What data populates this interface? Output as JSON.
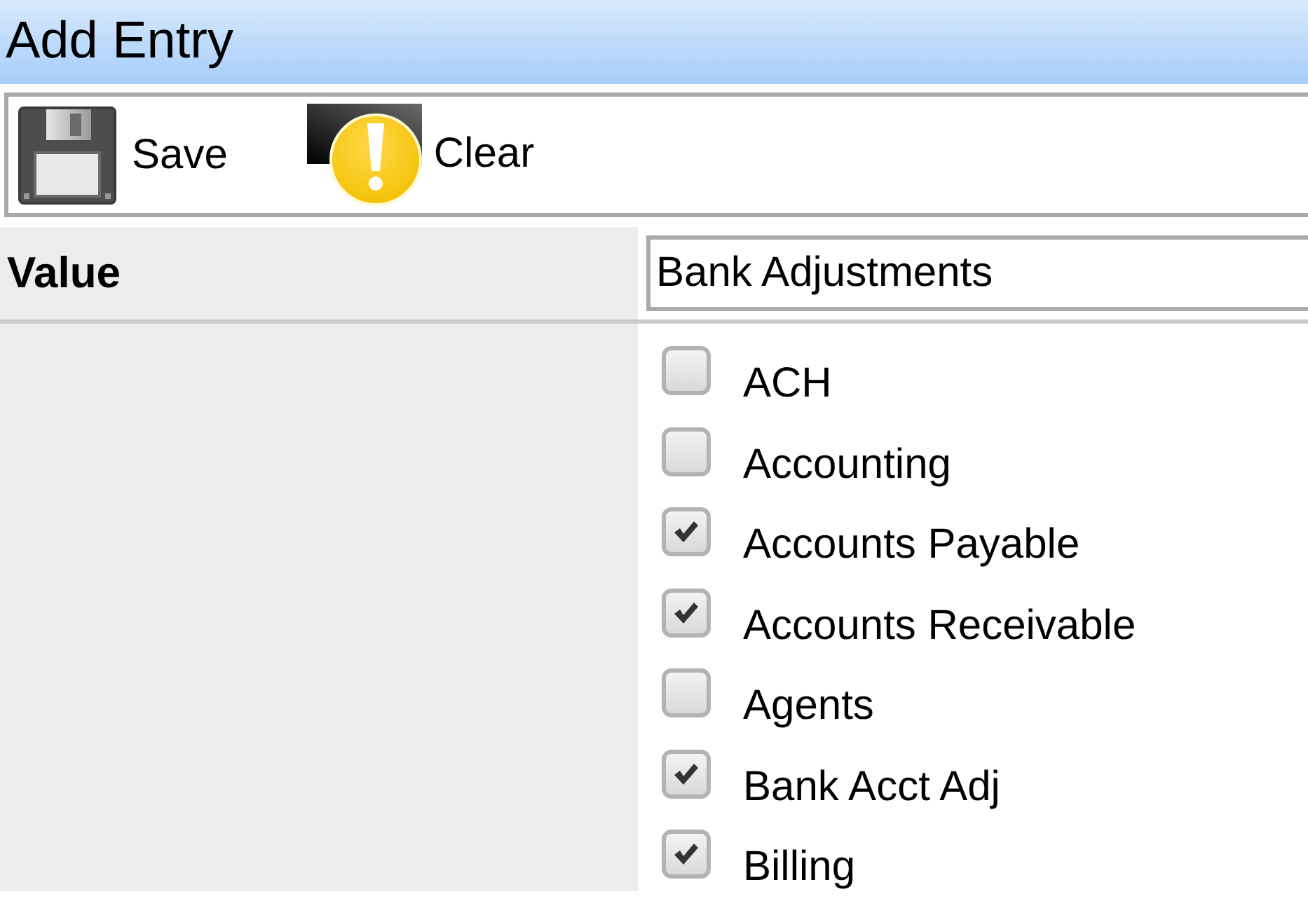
{
  "window": {
    "title": "Add Entry"
  },
  "toolbar": {
    "buttons": [
      {
        "kind": "save",
        "label": "Save"
      },
      {
        "kind": "clear",
        "label": "Clear"
      }
    ]
  },
  "form": {
    "field": {
      "label": "Value",
      "value": "Bank Adjustments"
    },
    "categories": [
      {
        "label": "ACH",
        "checked": false
      },
      {
        "label": "Accounting",
        "checked": false
      },
      {
        "label": "Accounts Payable",
        "checked": true
      },
      {
        "label": "Accounts Receivable",
        "checked": true
      },
      {
        "label": "Agents",
        "checked": false
      },
      {
        "label": "Bank Acct Adj",
        "checked": true
      },
      {
        "label": "Billing",
        "checked": true
      }
    ]
  }
}
